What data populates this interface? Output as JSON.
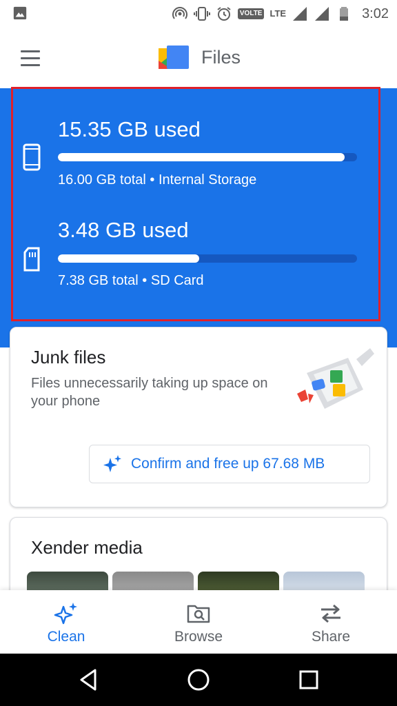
{
  "status_bar": {
    "time": "3:02",
    "volte_label": "VOLTE",
    "lte_label": "LTE",
    "icons": [
      "image-icon",
      "hotspot-icon",
      "vibrate-icon",
      "alarm-icon",
      "volte-icon",
      "lte-icon",
      "signal-icon",
      "signal-icon",
      "battery-icon"
    ]
  },
  "app_bar": {
    "title": "Files",
    "menu_icon": "hamburger-menu-icon",
    "logo_icon": "files-logo-icon"
  },
  "storage": {
    "internal": {
      "used": "15.35 GB used",
      "total": "16.00 GB total • Internal Storage",
      "fraction_used": 0.959,
      "icon": "phone-icon"
    },
    "sd_card": {
      "used": "3.48 GB used",
      "total": "7.38 GB total • SD Card",
      "fraction_used": 0.472,
      "icon": "sd-card-icon"
    },
    "colors": {
      "panel": "#1a73e8",
      "track": "#1558c0",
      "fill": "#ffffff",
      "highlight_border": "#e0202a"
    }
  },
  "junk_card": {
    "title": "Junk files",
    "description": "Files unnecessarily taking up space on your phone",
    "button_label": "Confirm and free up 67.68 MB",
    "button_icon": "sparkle-icon"
  },
  "xender_card": {
    "title": "Xender media"
  },
  "bottom_nav": {
    "items": [
      {
        "label": "Clean",
        "icon": "sparkle-icon",
        "active": true
      },
      {
        "label": "Browse",
        "icon": "folder-search-icon",
        "active": false
      },
      {
        "label": "Share",
        "icon": "swap-arrows-icon",
        "active": false
      }
    ],
    "active_color": "#1a73e8"
  },
  "system_nav": {
    "buttons": [
      "back-icon",
      "home-icon",
      "recents-icon"
    ]
  }
}
